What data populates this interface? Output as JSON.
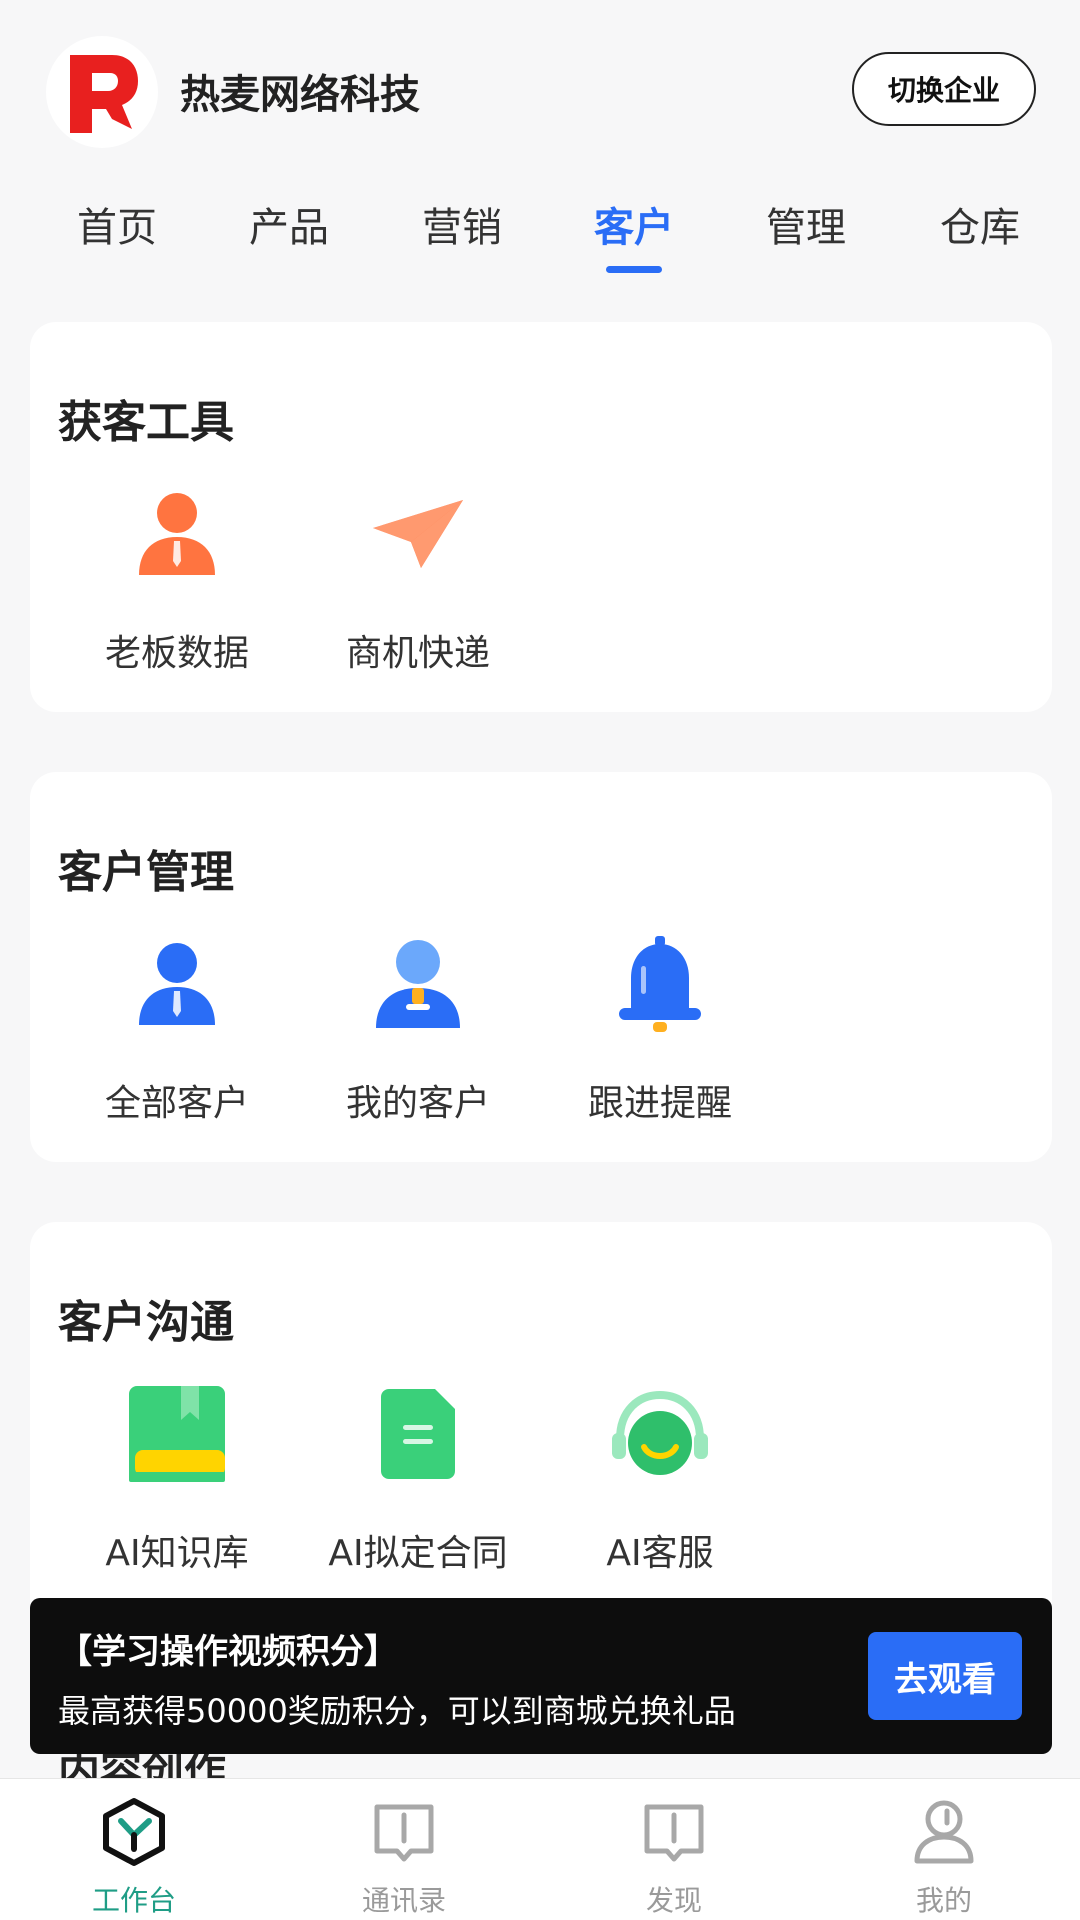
{
  "header": {
    "company_name": "热麦网络科技",
    "switch_button": "切换企业"
  },
  "tabs": [
    {
      "label": "首页"
    },
    {
      "label": "产品"
    },
    {
      "label": "营销"
    },
    {
      "label": "客户",
      "active": true
    },
    {
      "label": "管理"
    },
    {
      "label": "仓库"
    }
  ],
  "sections": [
    {
      "title": "获客工具",
      "items": [
        {
          "label": "老板数据",
          "icon": "boss-person-icon",
          "color": "#ff7440"
        },
        {
          "label": "商机快递",
          "icon": "paper-plane-icon",
          "color": "#ff7440"
        }
      ]
    },
    {
      "title": "客户管理",
      "items": [
        {
          "label": "全部客户",
          "icon": "person-icon",
          "color": "#2a6df6"
        },
        {
          "label": "我的客户",
          "icon": "my-customer-icon",
          "color": "#2a6df6"
        },
        {
          "label": "跟进提醒",
          "icon": "bell-icon",
          "color": "#2a6df6"
        }
      ]
    },
    {
      "title": "客户沟通",
      "items": [
        {
          "label": "AI知识库",
          "icon": "book-icon",
          "color": "#3ad07a"
        },
        {
          "label": "AI拟定合同",
          "icon": "document-icon",
          "color": "#3ad07a"
        },
        {
          "label": "AI客服",
          "icon": "headset-icon",
          "color": "#3ad07a"
        }
      ]
    }
  ],
  "next_section_peek": "内容创作",
  "toast": {
    "title": "【学习操作视频积分】",
    "description": "最高获得50000奖励积分，可以到商城兑换礼品",
    "button": "去观看"
  },
  "bottom_nav": [
    {
      "label": "工作台",
      "icon": "workbench-icon",
      "active": true
    },
    {
      "label": "通讯录",
      "icon": "contacts-icon"
    },
    {
      "label": "发现",
      "icon": "discover-icon"
    },
    {
      "label": "我的",
      "icon": "profile-icon"
    }
  ],
  "colors": {
    "accent": "#2a6df6",
    "nav_active": "#1f9d86",
    "orange": "#ff7440",
    "green": "#3ad07a",
    "logo_red": "#e8201f"
  }
}
